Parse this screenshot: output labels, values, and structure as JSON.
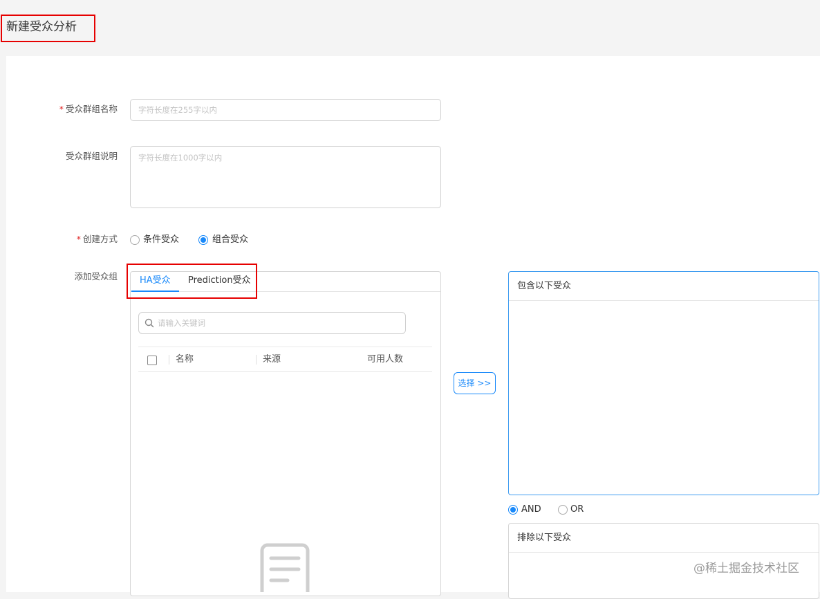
{
  "page": {
    "title": "新建受众分析"
  },
  "form": {
    "name_label": "受众群组名称",
    "name_placeholder": "字符长度在255字以内",
    "desc_label": "受众群组说明",
    "desc_placeholder": "字符长度在1000字以内",
    "method_label": "创建方式",
    "method_options": [
      {
        "label": "条件受众",
        "checked": false
      },
      {
        "label": "组合受众",
        "checked": true
      }
    ],
    "add_group_label": "添加受众组",
    "required_mark": "*"
  },
  "tabs": [
    {
      "label": "HA受众",
      "active": true
    },
    {
      "label": "Prediction受众",
      "active": false
    }
  ],
  "search": {
    "placeholder": "请输入关键词"
  },
  "table": {
    "columns": [
      "名称",
      "来源",
      "可用人数"
    ]
  },
  "select_button": "选择 >>",
  "include_box": {
    "title": "包含以下受众"
  },
  "logic": [
    {
      "label": "AND",
      "checked": true
    },
    {
      "label": "OR",
      "checked": false
    }
  ],
  "exclude_box": {
    "title": "排除以下受众"
  },
  "watermark": "@稀土掘金技术社区",
  "colors": {
    "accent": "#1989fa",
    "highlight_box": "#e60000"
  }
}
